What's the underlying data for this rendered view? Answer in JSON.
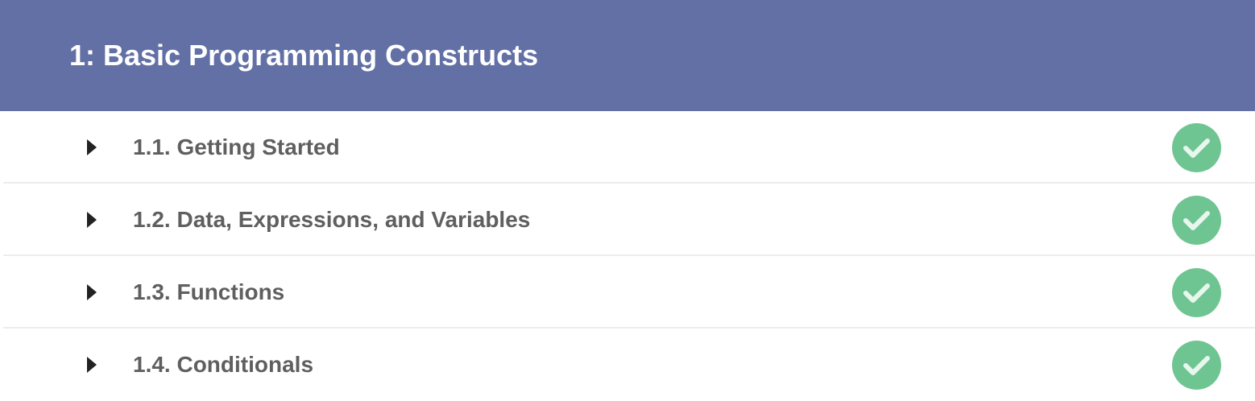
{
  "module": {
    "title": "1: Basic Programming Constructs",
    "header_color": "#6270a6"
  },
  "lessons": [
    {
      "label": "1.1. Getting Started",
      "status": "complete",
      "icon": "check-circle-icon"
    },
    {
      "label": "1.2. Data, Expressions, and Variables",
      "status": "complete",
      "icon": "check-circle-icon"
    },
    {
      "label": "1.3. Functions",
      "status": "complete",
      "icon": "check-circle-icon"
    },
    {
      "label": "1.4. Conditionals",
      "status": "complete",
      "icon": "check-circle-icon"
    }
  ],
  "colors": {
    "complete": "#6fc592",
    "check_mark": "#e8f7ee",
    "lesson_text": "#5f5f5f"
  }
}
